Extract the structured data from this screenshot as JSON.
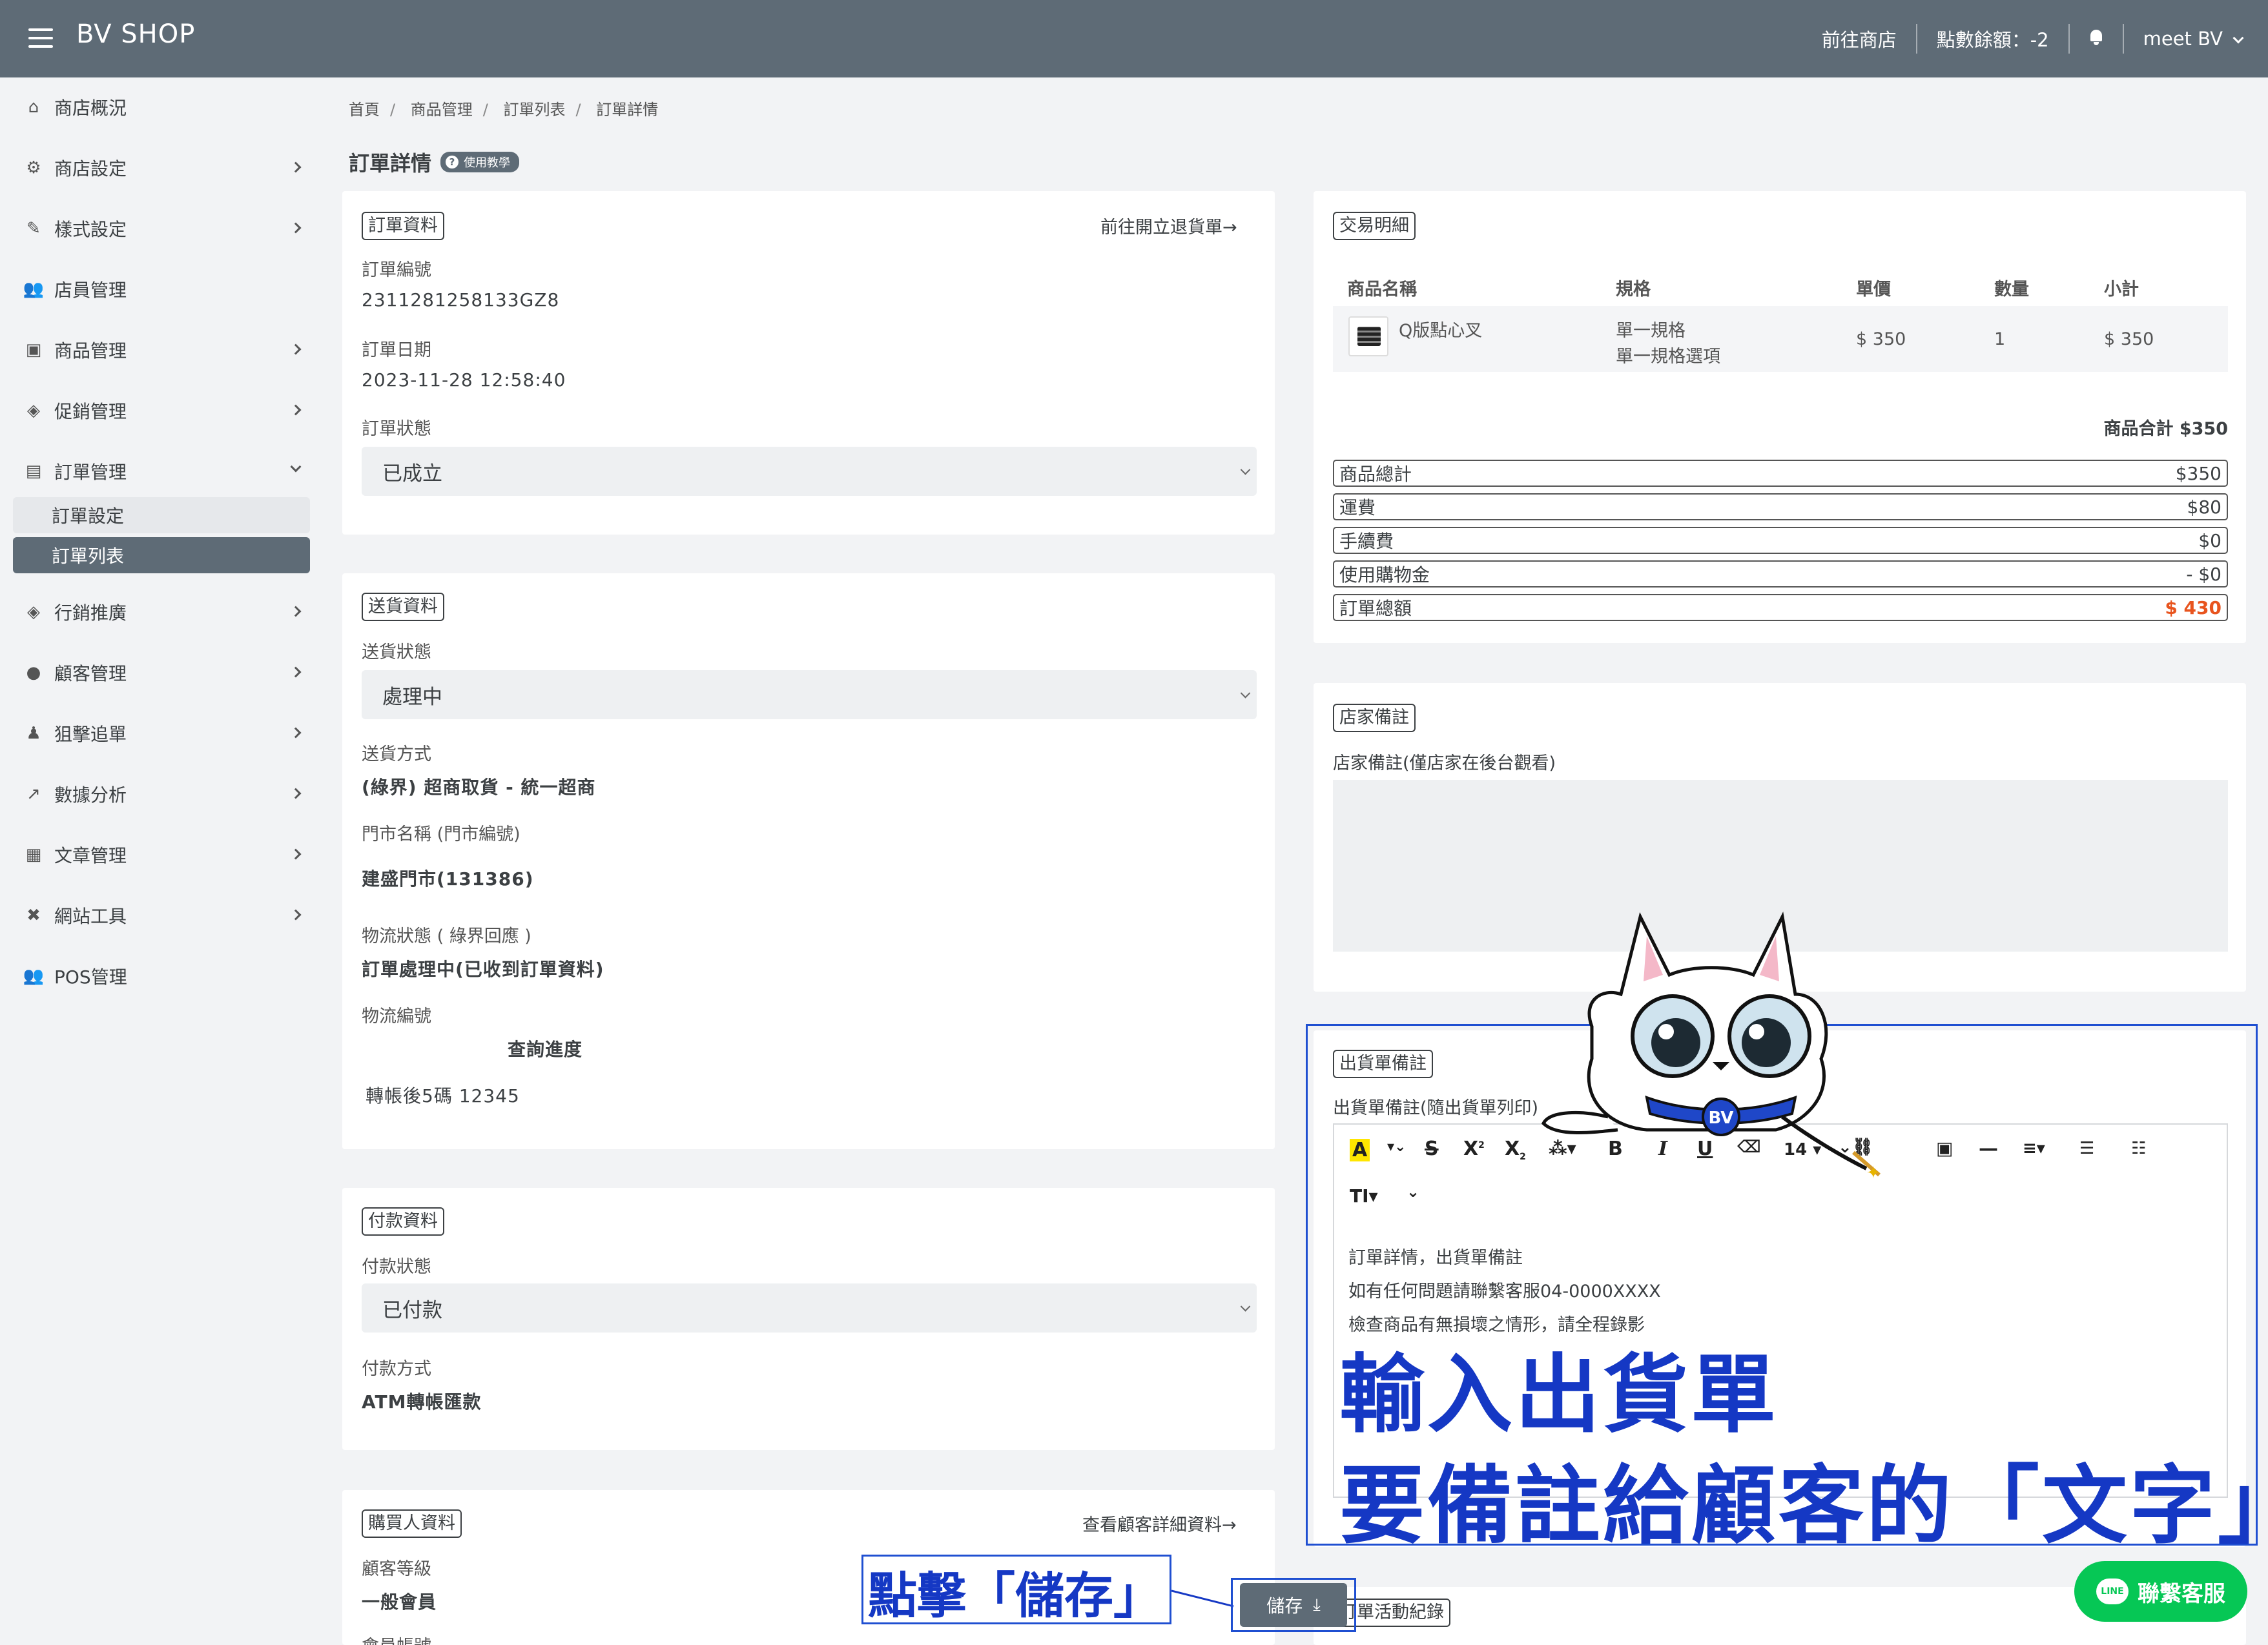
{
  "header": {
    "brand": "BV SHOP",
    "go_store": "前往商店",
    "points": "點數餘額：-2",
    "user": "meet BV"
  },
  "sidebar": {
    "items": [
      {
        "label": "商店概況",
        "icon": "home-icon"
      },
      {
        "label": "商店設定",
        "icon": "gear-icon"
      },
      {
        "label": "樣式設定",
        "icon": "magic-wand-icon"
      },
      {
        "label": "店員管理",
        "icon": "users-icon"
      },
      {
        "label": "商品管理",
        "icon": "box-icon"
      },
      {
        "label": "促銷管理",
        "icon": "tags-icon"
      },
      {
        "label": "訂單管理",
        "icon": "clipboard-icon"
      },
      {
        "label": "行銷推廣",
        "icon": "tags-icon"
      },
      {
        "label": "顧客管理",
        "icon": "user-circle-icon"
      },
      {
        "label": "狙擊追單",
        "icon": "sniper-icon"
      },
      {
        "label": "數據分析",
        "icon": "line-chart-icon"
      },
      {
        "label": "文章管理",
        "icon": "newspaper-icon"
      },
      {
        "label": "網站工具",
        "icon": "tools-icon"
      },
      {
        "label": "POS管理",
        "icon": "users-icon"
      }
    ],
    "sub_items": [
      "訂單設定",
      "訂單列表"
    ]
  },
  "breadcrumb": [
    "首頁",
    "商品管理",
    "訂單列表",
    "訂單詳情"
  ],
  "page": {
    "title": "訂單詳情",
    "tutorial": "使用教學"
  },
  "order": {
    "tag": "訂單資料",
    "return_link": "前往開立退貨單→",
    "number_label": "訂單編號",
    "number": "2311281258133GZ8",
    "date_label": "訂單日期",
    "date": "2023-11-28 12:58:40",
    "status_label": "訂單狀態",
    "status": "已成立"
  },
  "shipping": {
    "tag": "送貨資料",
    "status_label": "送貨狀態",
    "status": "處理中",
    "method_label": "送貨方式",
    "method": "(綠界) 超商取貨 - 統一超商",
    "store_label": "門市名稱 (門市編號)",
    "store": "建盛門市(131386)",
    "logistics_status_label": "物流狀態 ( 綠界回應 )",
    "logistics_status": "訂單處理中(已收到訂單資料)",
    "tracking_label": "物流編號",
    "query": "查詢進度",
    "transfer": "轉帳後5碼 12345"
  },
  "payment": {
    "tag": "付款資料",
    "status_label": "付款狀態",
    "status": "已付款",
    "method_label": "付款方式",
    "method": "ATM轉帳匯款"
  },
  "buyer": {
    "tag": "購買人資料",
    "detail_link": "查看顧客詳細資料→",
    "level_label": "顧客等級",
    "level": "一般會員",
    "account_label": "會員帳號"
  },
  "transaction": {
    "tag": "交易明細",
    "columns": [
      "商品名稱",
      "規格",
      "單價",
      "數量",
      "小計"
    ],
    "rows": [
      {
        "name": "Q版點心叉",
        "spec1": "單一規格",
        "spec2": "單一規格選項",
        "price": "$ 350",
        "qty": "1",
        "subtotal": "$ 350"
      }
    ],
    "product_total": "商品合計 $350",
    "summary": [
      {
        "label": "商品總計",
        "value": "$350"
      },
      {
        "label": "運費",
        "value": "$80"
      },
      {
        "label": "手續費",
        "value": "$0"
      },
      {
        "label": "使用購物金",
        "value": "- $0"
      },
      {
        "label": "訂單總額",
        "value": "$ 430"
      }
    ]
  },
  "merchant_note": {
    "tag": "店家備註",
    "label": "店家備註(僅店家在後台觀看)"
  },
  "shipping_note": {
    "tag": "出貨單備註",
    "label": "出貨單備註(隨出貨單列印)",
    "font_size": "14",
    "lines": [
      "訂單詳情，出貨單備註",
      "如有任何問題請聯繫客服04-0000XXXX",
      "檢查商品有無損壞之情形，請全程錄影"
    ]
  },
  "activity": {
    "tag": "訂單活動紀錄"
  },
  "annotations": {
    "line1": "輸入出貨單",
    "line2": "要備註給顧客的「文字」",
    "callout": "點擊「儲存」",
    "mascot_label": "BV"
  },
  "save_button": "儲存",
  "line_contact": "聯繫客服",
  "colors": {
    "topbar": "#5e6b76",
    "accent_total": "#e8541e",
    "annotation_blue": "#1538c4",
    "line_green": "#06c755"
  }
}
